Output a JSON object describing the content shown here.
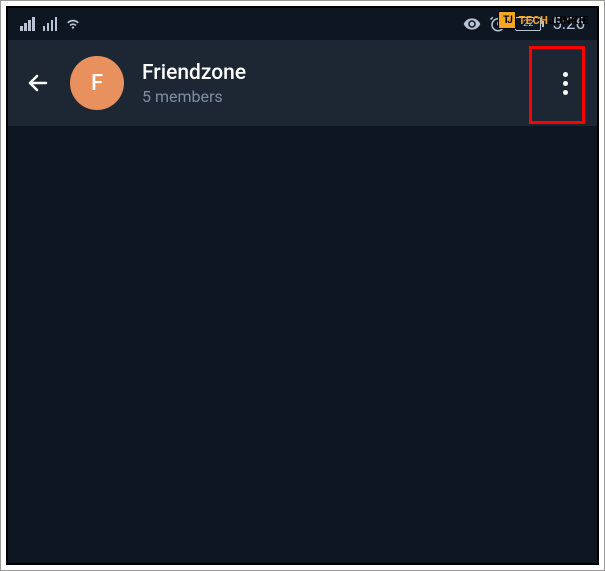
{
  "watermark": {
    "logo_text": "TJ",
    "tech": "TECH",
    "junkie": "JUNKIE"
  },
  "status_bar": {
    "battery_level": "22",
    "time": "5:26"
  },
  "header": {
    "avatar_letter": "F",
    "title": "Friendzone",
    "subtitle": "5 members"
  }
}
